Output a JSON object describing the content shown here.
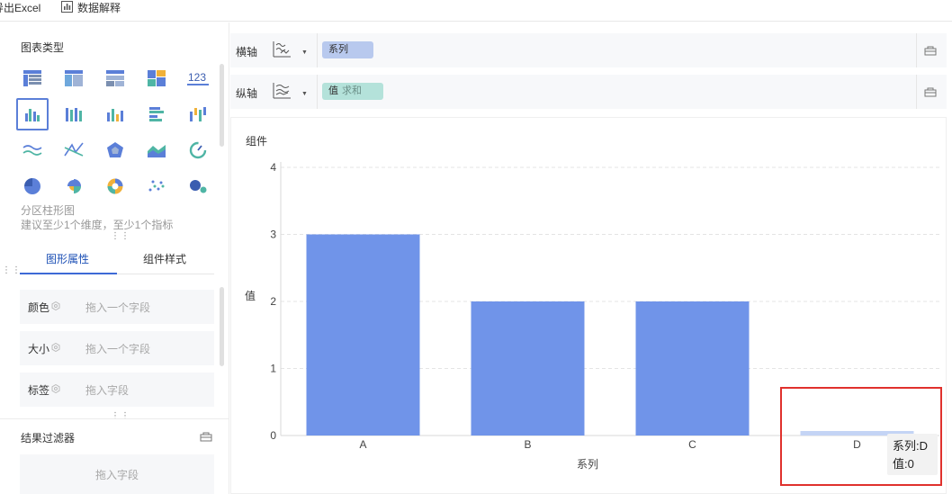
{
  "toolbar": {
    "export_label": "导出Excel",
    "data_explain_label": "数据解释"
  },
  "left_panel": {
    "section_title": "图表类型",
    "chart_types": [
      {
        "icon": "table-icon"
      },
      {
        "icon": "cross-table-icon"
      },
      {
        "icon": "detail-table-icon"
      },
      {
        "icon": "treemap-icon"
      },
      {
        "icon": "kpi-number-icon",
        "text": "123"
      },
      {
        "icon": "grouped-bar-icon",
        "active": true
      },
      {
        "icon": "stacked-bar-icon"
      },
      {
        "icon": "multi-bar-icon"
      },
      {
        "icon": "horizontal-bar-icon"
      },
      {
        "icon": "range-bar-icon"
      },
      {
        "icon": "line-icon"
      },
      {
        "icon": "scatter-line-icon"
      },
      {
        "icon": "radar-icon"
      },
      {
        "icon": "area-icon"
      },
      {
        "icon": "gauge-icon"
      },
      {
        "icon": "pie-icon"
      },
      {
        "icon": "rose-pie-icon"
      },
      {
        "icon": "globe-icon"
      },
      {
        "icon": "dot-scatter-icon"
      },
      {
        "icon": "bubble-icon"
      }
    ],
    "chart_desc_title": "分区柱形图",
    "chart_desc_hint": "建议至少1个维度，至少1个指标",
    "tabs": [
      "图形属性",
      "组件样式"
    ],
    "properties": [
      {
        "label": "颜色",
        "placeholder": "拖入一个字段"
      },
      {
        "label": "大小",
        "placeholder": "拖入一个字段"
      },
      {
        "label": "标签",
        "placeholder": "拖入字段"
      }
    ],
    "filter_title": "结果过滤器",
    "filter_placeholder": "拖入字段"
  },
  "axes": {
    "x_label": "横轴",
    "x_field": "系列",
    "y_label": "纵轴",
    "y_field": "值",
    "y_agg": "求和"
  },
  "chart_panel": {
    "title": "组件"
  },
  "chart_data": {
    "type": "bar",
    "categories": [
      "A",
      "B",
      "C",
      "D"
    ],
    "values": [
      3,
      2,
      2,
      0
    ],
    "xlabel": "系列",
    "ylabel": "值",
    "ylim": [
      0,
      4
    ],
    "yticks": [
      0,
      1,
      2,
      3,
      4
    ],
    "bar_color": "#7094e9",
    "highlight_color": "#c4d4f5",
    "grid": true
  },
  "tooltip": {
    "line1": "系列:D",
    "line2": "值:0"
  },
  "colors": {
    "accent": "#3d6ad6",
    "highlight_border": "#e0312d"
  }
}
